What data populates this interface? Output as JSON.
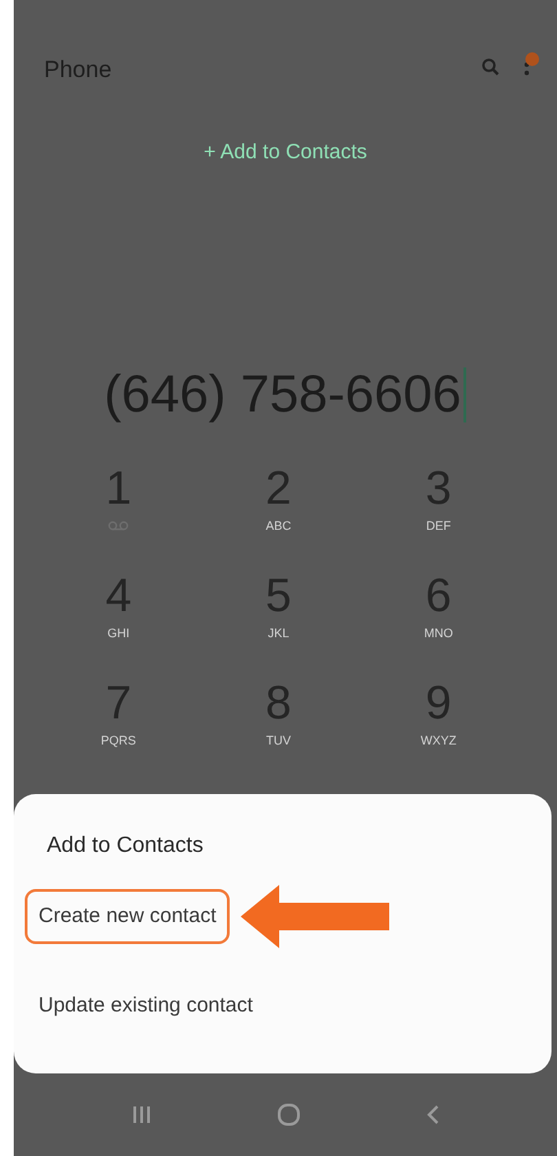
{
  "app_bar": {
    "title": "Phone"
  },
  "add_link": {
    "label": "+ Add to Contacts"
  },
  "dialed_number": "(646) 758-6606",
  "keypad": [
    {
      "digit": "1",
      "kind": "voicemail"
    },
    {
      "digit": "2",
      "letters": "ABC",
      "kind": "letters"
    },
    {
      "digit": "3",
      "letters": "DEF",
      "kind": "letters"
    },
    {
      "digit": "4",
      "letters": "GHI",
      "kind": "letters"
    },
    {
      "digit": "5",
      "letters": "JKL",
      "kind": "letters"
    },
    {
      "digit": "6",
      "letters": "MNO",
      "kind": "letters"
    },
    {
      "digit": "7",
      "letters": "PQRS",
      "kind": "letters"
    },
    {
      "digit": "8",
      "letters": "TUV",
      "kind": "letters"
    },
    {
      "digit": "9",
      "letters": "WXYZ",
      "kind": "letters"
    }
  ],
  "sheet": {
    "title": "Add to Contacts",
    "options": [
      {
        "label": "Create new contact",
        "selected": true
      },
      {
        "label": "Update existing contact",
        "selected": false
      }
    ]
  }
}
